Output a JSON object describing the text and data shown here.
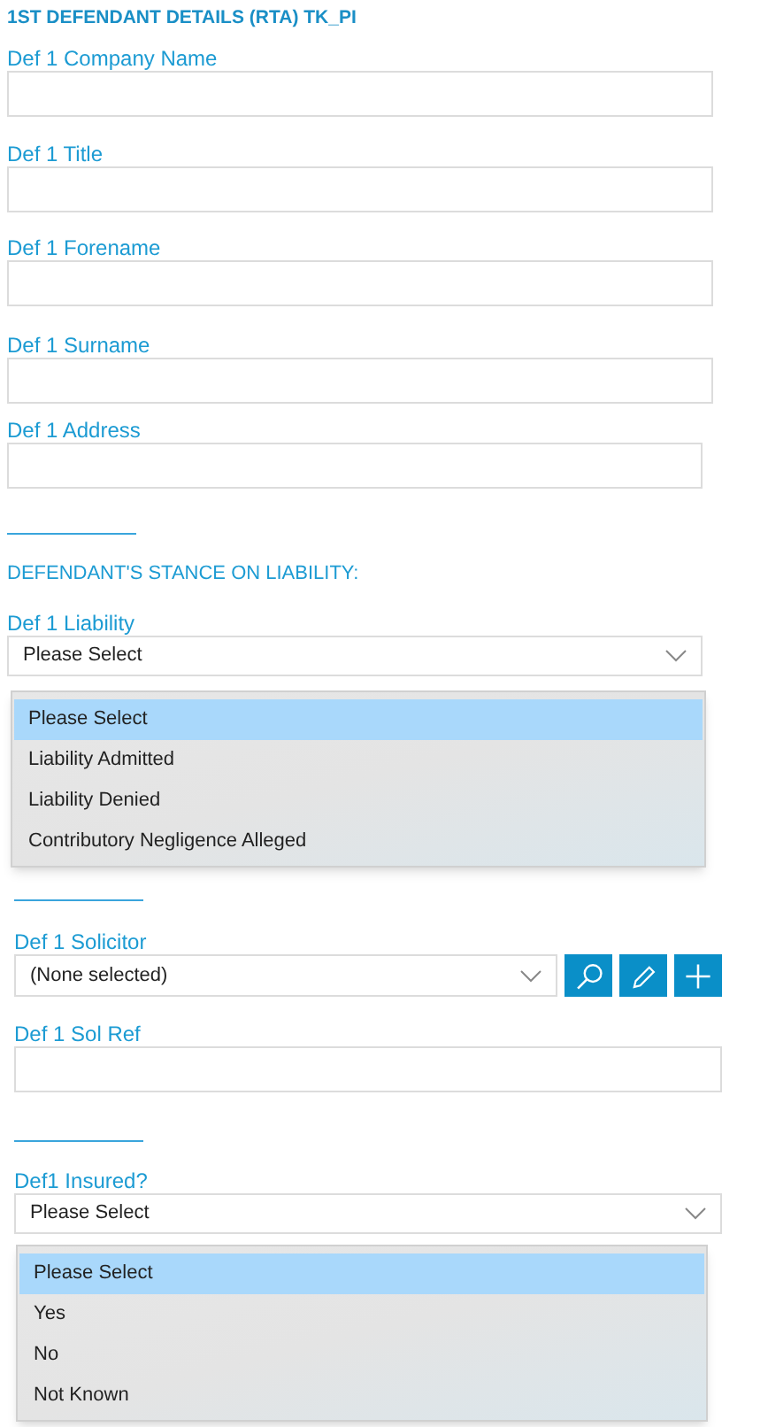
{
  "heading": "1ST DEFENDANT DETAILS (RTA) TK_PI",
  "details_fields": [
    {
      "label": "Def 1 Company Name"
    },
    {
      "label": "Def 1 Title"
    },
    {
      "label": "Def 1 Forename"
    },
    {
      "label": "Def 1 Surname"
    },
    {
      "label": "Def 1 Address"
    }
  ],
  "liability": {
    "subheading": "DEFENDANT'S STANCE ON LIABILITY:",
    "label": "Def 1 Liability",
    "value": "Please Select",
    "expanded": true,
    "options": [
      {
        "label": "Please Select",
        "selected": true
      },
      {
        "label": "Liability Admitted",
        "selected": false
      },
      {
        "label": "Liability Denied",
        "selected": false
      },
      {
        "label": "Contributory Negligence Alleged",
        "selected": false
      }
    ]
  },
  "solicitor": {
    "label": "Def 1 Solicitor",
    "value": "(None selected)",
    "buttons": [
      {
        "kind": "search"
      },
      {
        "kind": "edit"
      },
      {
        "kind": "add"
      }
    ]
  },
  "sol_ref": {
    "label": "Def 1 Sol Ref"
  },
  "insured": {
    "label": "Def1 Insured?",
    "value": "Please Select",
    "expanded": true,
    "options": [
      {
        "label": "Please Select",
        "selected": true
      },
      {
        "label": "Yes",
        "selected": false
      },
      {
        "label": "No",
        "selected": false
      },
      {
        "label": "Not Known",
        "selected": false
      }
    ]
  }
}
